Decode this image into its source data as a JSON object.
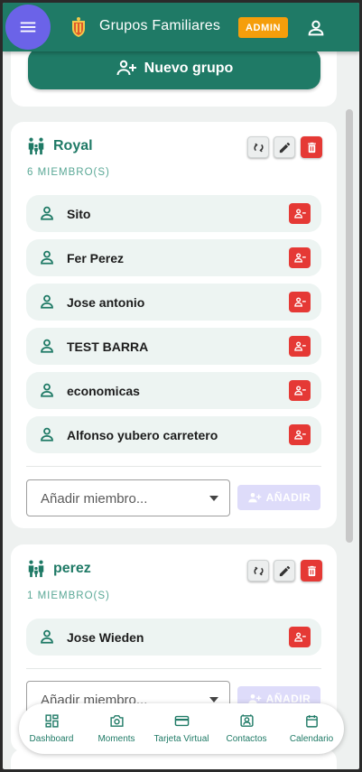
{
  "header": {
    "title": "Grupos Familiares",
    "badge": "ADMIN",
    "icons": {
      "menu": "menu-icon",
      "logo": "crest-logo",
      "user": "user-icon"
    }
  },
  "top": {
    "new_group_label": "Nuevo grupo"
  },
  "groups": [
    {
      "name": "Royal",
      "count": "6 MIEMBRO(S)",
      "members": [
        "Sito",
        "Fer Perez",
        "Jose antonio",
        "TEST BARRA",
        "economicas",
        "Alfonso yubero carretero"
      ],
      "add_placeholder": "Añadir miembro...",
      "add_label": "AÑADIR"
    },
    {
      "name": "perez",
      "count": "1 MIEMBRO(S)",
      "members": [
        "Jose Wieden"
      ],
      "add_placeholder": "Añadir miembro...",
      "add_label": "AÑADIR"
    }
  ],
  "nav": {
    "items": [
      "Dashboard",
      "Moments",
      "Tarjeta Virtual",
      "Contactos",
      "Calendario"
    ]
  },
  "colors": {
    "primary": "#1f7a66",
    "menu_button": "#6b63e8",
    "badge": "#f59e0b",
    "danger": "#e53935",
    "disabled_button": "#dedcfa"
  }
}
